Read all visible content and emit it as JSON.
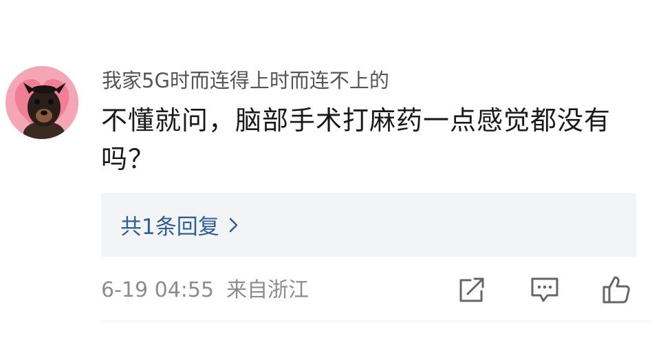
{
  "comment": {
    "username": "我家5G时而连得上时而连不上的",
    "text": "不懂就问，脑部手术打麻药一点感觉都没有吗？",
    "reply_link": "共1条回复",
    "timestamp": "6-19 04:55",
    "location": "来自浙江"
  },
  "icons": {
    "chevron": "chevron-right-icon",
    "share": "share-icon",
    "reply": "comment-icon",
    "like": "thumbs-up-icon"
  },
  "colors": {
    "avatar_bg": "#f4a6b5",
    "link": "#2f5f96",
    "reply_bg": "#f3f4f6",
    "meta": "#8c8c8c"
  }
}
